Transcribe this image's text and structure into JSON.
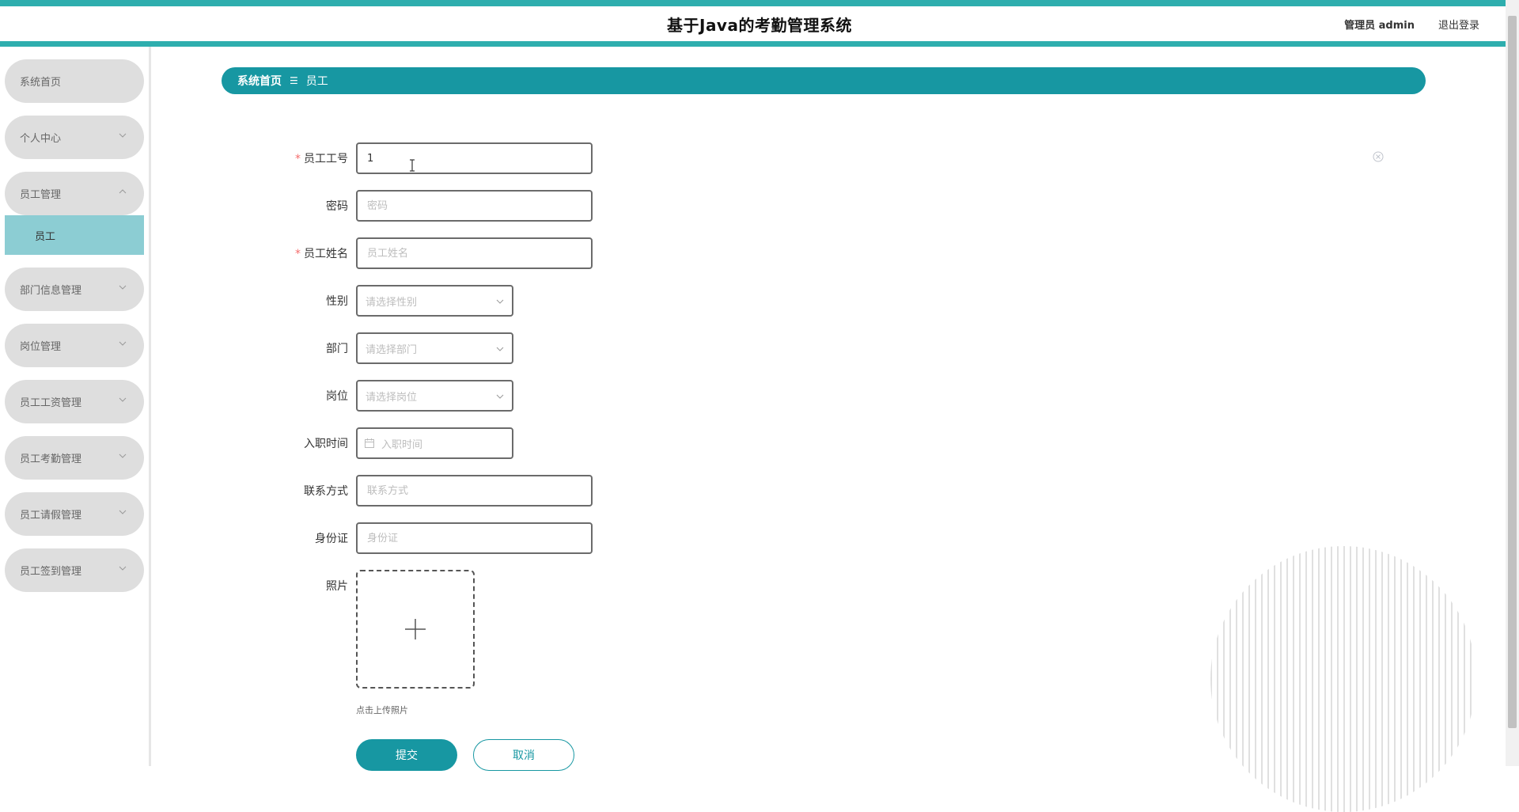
{
  "header": {
    "title": "基于Java的考勤管理系统",
    "admin_label": "管理员 admin",
    "logout_label": "退出登录"
  },
  "sidebar": {
    "items": [
      {
        "label": "系统首页",
        "has_chevron": false
      },
      {
        "label": "个人中心",
        "has_chevron": true
      },
      {
        "label": "员工管理",
        "has_chevron": true,
        "expanded": true,
        "children": [
          "员工"
        ]
      },
      {
        "label": "部门信息管理",
        "has_chevron": true
      },
      {
        "label": "岗位管理",
        "has_chevron": true
      },
      {
        "label": "员工工资管理",
        "has_chevron": true
      },
      {
        "label": "员工考勤管理",
        "has_chevron": true
      },
      {
        "label": "员工请假管理",
        "has_chevron": true
      },
      {
        "label": "员工签到管理",
        "has_chevron": true
      }
    ]
  },
  "breadcrumb": {
    "home": "系统首页",
    "separator": "☰",
    "current": "员工"
  },
  "form": {
    "employee_no": {
      "label": "员工工号",
      "required": true,
      "value": "1"
    },
    "password": {
      "label": "密码",
      "required": false,
      "placeholder": "密码"
    },
    "employee_name": {
      "label": "员工姓名",
      "required": true,
      "placeholder": "员工姓名"
    },
    "gender": {
      "label": "性别",
      "placeholder": "请选择性别"
    },
    "department": {
      "label": "部门",
      "placeholder": "请选择部门"
    },
    "position": {
      "label": "岗位",
      "placeholder": "请选择岗位"
    },
    "hire_date": {
      "label": "入职时间",
      "placeholder": "入职时间"
    },
    "contact": {
      "label": "联系方式",
      "placeholder": "联系方式"
    },
    "id_card": {
      "label": "身份证",
      "placeholder": "身份证"
    },
    "photo": {
      "label": "照片",
      "hint": "点击上传照片"
    },
    "required_mark": "*"
  },
  "buttons": {
    "submit": "提交",
    "cancel": "取消"
  },
  "colors": {
    "accent": "#1797a2",
    "stripe": "#2eaeae",
    "submenu_active": "#8ccdd3",
    "menu_bg": "#dedede"
  }
}
